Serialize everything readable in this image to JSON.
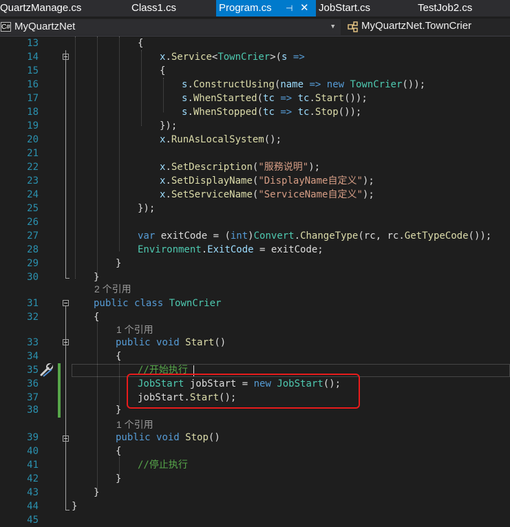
{
  "tabs": [
    {
      "label": "QuartzManage.cs",
      "active": false
    },
    {
      "label": "Class1.cs",
      "active": false
    },
    {
      "label": "Program.cs",
      "active": true
    },
    {
      "label": "JobStart.cs",
      "active": false
    },
    {
      "label": "TestJob2.cs",
      "active": false
    }
  ],
  "nav": {
    "project_icon": "C#",
    "project": "MyQuartzNet",
    "member": "MyQuartzNet.TownCrier",
    "class_icon": "class-icon"
  },
  "lines": [
    {
      "n": "13",
      "tokens": [
        [
          "",
          "{"
        ]
      ]
    },
    {
      "n": "14",
      "tokens": [
        [
          "vr",
          "x"
        ],
        [
          "",
          "."
        ],
        [
          "fn",
          "Service"
        ],
        [
          "",
          "<"
        ],
        [
          "ty",
          "TownCrier"
        ],
        [
          "",
          ">("
        ],
        [
          "vr",
          "s"
        ],
        [
          "",
          " "
        ],
        [
          "kw",
          "=>"
        ]
      ]
    },
    {
      "n": "15",
      "tokens": [
        [
          "",
          "{"
        ]
      ]
    },
    {
      "n": "16",
      "tokens": [
        [
          "vr",
          "s"
        ],
        [
          "",
          "."
        ],
        [
          "fn",
          "ConstructUsing"
        ],
        [
          "",
          "("
        ],
        [
          "vr",
          "name"
        ],
        [
          "",
          " "
        ],
        [
          "kw",
          "=>"
        ],
        [
          "",
          " "
        ],
        [
          "kw",
          "new"
        ],
        [
          "",
          " "
        ],
        [
          "ty",
          "TownCrier"
        ],
        [
          "",
          "());"
        ]
      ]
    },
    {
      "n": "17",
      "tokens": [
        [
          "vr",
          "s"
        ],
        [
          "",
          "."
        ],
        [
          "fn",
          "WhenStarted"
        ],
        [
          "",
          "("
        ],
        [
          "vr",
          "tc"
        ],
        [
          "",
          " "
        ],
        [
          "kw",
          "=>"
        ],
        [
          "",
          " "
        ],
        [
          "vr",
          "tc"
        ],
        [
          "",
          "."
        ],
        [
          "fn",
          "Start"
        ],
        [
          "",
          "());"
        ]
      ]
    },
    {
      "n": "18",
      "tokens": [
        [
          "vr",
          "s"
        ],
        [
          "",
          "."
        ],
        [
          "fn",
          "WhenStopped"
        ],
        [
          "",
          "("
        ],
        [
          "vr",
          "tc"
        ],
        [
          "",
          " "
        ],
        [
          "kw",
          "=>"
        ],
        [
          "",
          " "
        ],
        [
          "vr",
          "tc"
        ],
        [
          "",
          "."
        ],
        [
          "fn",
          "Stop"
        ],
        [
          "",
          "());"
        ]
      ]
    },
    {
      "n": "19",
      "tokens": [
        [
          "",
          "});"
        ]
      ]
    },
    {
      "n": "20",
      "tokens": [
        [
          "vr",
          "x"
        ],
        [
          "",
          "."
        ],
        [
          "fn",
          "RunAsLocalSystem"
        ],
        [
          "",
          "();"
        ]
      ]
    },
    {
      "n": "21",
      "tokens": []
    },
    {
      "n": "22",
      "tokens": [
        [
          "vr",
          "x"
        ],
        [
          "",
          "."
        ],
        [
          "fn",
          "SetDescription"
        ],
        [
          "",
          "("
        ],
        [
          "st",
          "\"服務说明\""
        ],
        [
          "",
          ");"
        ]
      ]
    },
    {
      "n": "23",
      "tokens": [
        [
          "vr",
          "x"
        ],
        [
          "",
          "."
        ],
        [
          "fn",
          "SetDisplayName"
        ],
        [
          "",
          "("
        ],
        [
          "st",
          "\"DisplayName自定义\""
        ],
        [
          "",
          ");"
        ]
      ]
    },
    {
      "n": "24",
      "tokens": [
        [
          "vr",
          "x"
        ],
        [
          "",
          "."
        ],
        [
          "fn",
          "SetServiceName"
        ],
        [
          "",
          "("
        ],
        [
          "st",
          "\"ServiceName自定义\""
        ],
        [
          "",
          ");"
        ]
      ]
    },
    {
      "n": "25",
      "tokens": [
        [
          "",
          "});"
        ]
      ]
    },
    {
      "n": "26",
      "tokens": []
    },
    {
      "n": "27",
      "tokens": [
        [
          "kw",
          "var"
        ],
        [
          "",
          " exitCode = ("
        ],
        [
          "kw",
          "int"
        ],
        [
          "",
          ")"
        ],
        [
          "ty",
          "Convert"
        ],
        [
          "",
          "."
        ],
        [
          "fn",
          "ChangeType"
        ],
        [
          "",
          "(rc, rc."
        ],
        [
          "fn",
          "GetTypeCode"
        ],
        [
          "",
          "());"
        ]
      ]
    },
    {
      "n": "28",
      "tokens": [
        [
          "ty",
          "Environment"
        ],
        [
          "",
          "."
        ],
        [
          "vr",
          "ExitCode"
        ],
        [
          "",
          " = exitCode;"
        ]
      ]
    },
    {
      "n": "29",
      "tokens": [
        [
          "",
          "}"
        ]
      ]
    },
    {
      "n": "30",
      "tokens": [
        [
          "",
          "}"
        ]
      ]
    },
    {
      "n": "31",
      "tokens": [
        [
          "kw",
          "public"
        ],
        [
          "",
          " "
        ],
        [
          "kw",
          "class"
        ],
        [
          "",
          " "
        ],
        [
          "ty",
          "TownCrier"
        ]
      ]
    },
    {
      "n": "32",
      "tokens": [
        [
          "",
          "{"
        ]
      ]
    },
    {
      "n": "33",
      "tokens": [
        [
          "kw",
          "public"
        ],
        [
          "",
          " "
        ],
        [
          "kw",
          "void"
        ],
        [
          "",
          " "
        ],
        [
          "fn",
          "Start"
        ],
        [
          "",
          "()"
        ]
      ]
    },
    {
      "n": "34",
      "tokens": [
        [
          "",
          "{"
        ]
      ]
    },
    {
      "n": "35",
      "tokens": [
        [
          "cm",
          "//开始执行"
        ]
      ]
    },
    {
      "n": "36",
      "tokens": [
        [
          "ty",
          "JobStart"
        ],
        [
          "",
          " jobStart = "
        ],
        [
          "kw",
          "new"
        ],
        [
          "",
          " "
        ],
        [
          "ty",
          "JobStart"
        ],
        [
          "",
          "();"
        ]
      ]
    },
    {
      "n": "37",
      "tokens": [
        [
          "",
          "jobStart."
        ],
        [
          "fn",
          "Start"
        ],
        [
          "",
          "();"
        ]
      ]
    },
    {
      "n": "38",
      "tokens": [
        [
          "",
          "}"
        ]
      ]
    },
    {
      "n": "39",
      "tokens": [
        [
          "kw",
          "public"
        ],
        [
          "",
          " "
        ],
        [
          "kw",
          "void"
        ],
        [
          "",
          " "
        ],
        [
          "fn",
          "Stop"
        ],
        [
          "",
          "()"
        ]
      ]
    },
    {
      "n": "40",
      "tokens": [
        [
          "",
          "{"
        ]
      ]
    },
    {
      "n": "41",
      "tokens": [
        [
          "cm",
          "//停止执行"
        ]
      ]
    },
    {
      "n": "42",
      "tokens": [
        [
          "",
          "}"
        ]
      ]
    },
    {
      "n": "43",
      "tokens": [
        [
          "",
          "}"
        ]
      ]
    },
    {
      "n": "44",
      "tokens": [
        [
          "",
          "}"
        ]
      ]
    },
    {
      "n": "45",
      "tokens": []
    }
  ],
  "codelens": [
    "2 个引用",
    "1 个引用",
    "1 个引用"
  ],
  "colors": {
    "background": "#1e1e1e",
    "active_tab": "#007acc",
    "line_number": "#2b91af",
    "keyword": "#569cd6",
    "type": "#4ec9b0",
    "method": "#dcdcaa",
    "string": "#d69d85",
    "comment": "#57a64a",
    "highlight_box": "#e81b1b"
  }
}
